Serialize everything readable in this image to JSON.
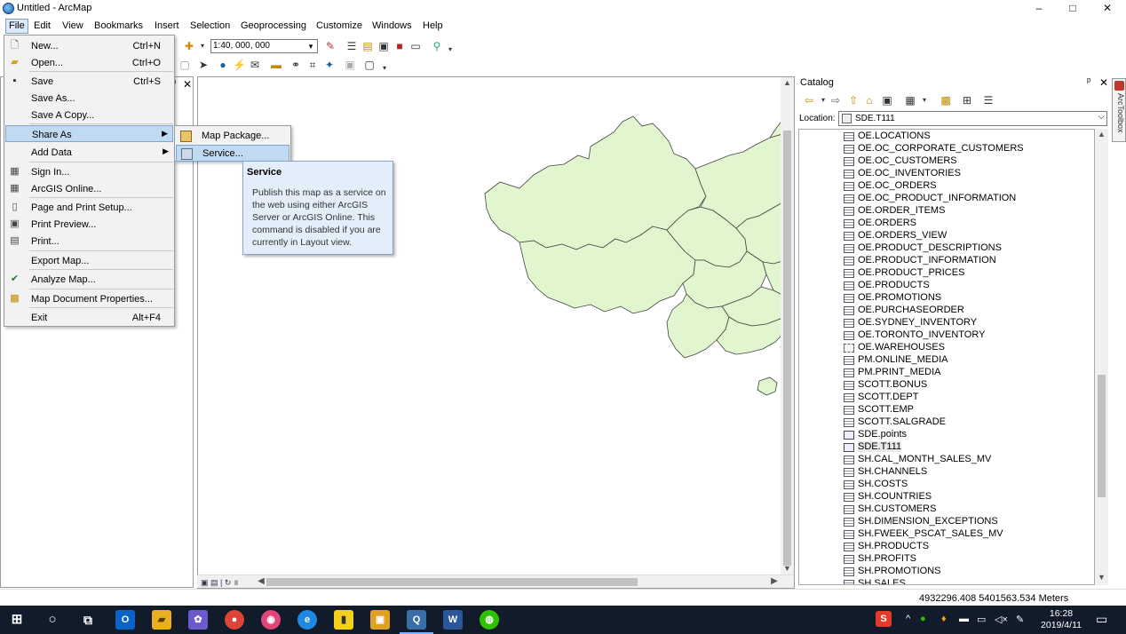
{
  "window": {
    "title": "Untitled - ArcMap",
    "controls": {
      "minimize": "–",
      "maximize": "□",
      "close": "✕"
    }
  },
  "menubar": [
    "File",
    "Edit",
    "View",
    "Bookmarks",
    "Insert",
    "Selection",
    "Geoprocessing",
    "Customize",
    "Windows",
    "Help"
  ],
  "toolbar": {
    "scale": "1:40, 000, 000"
  },
  "file_menu": {
    "items": [
      {
        "label": "New...",
        "shortcut": "Ctrl+N",
        "icon": "new-doc-icon"
      },
      {
        "label": "Open...",
        "shortcut": "Ctrl+O",
        "icon": "open-folder-icon"
      },
      {
        "label": "Save",
        "shortcut": "Ctrl+S",
        "icon": "save-icon"
      },
      {
        "label": "Save As...",
        "shortcut": "",
        "icon": ""
      },
      {
        "label": "Save A Copy...",
        "shortcut": "",
        "icon": ""
      },
      {
        "label": "Share As",
        "shortcut": "",
        "icon": "",
        "submenu": true
      },
      {
        "label": "Add Data",
        "shortcut": "",
        "icon": "",
        "submenu": true
      },
      {
        "label": "Sign In...",
        "shortcut": "",
        "icon": "sign-in-icon"
      },
      {
        "label": "ArcGIS Online...",
        "shortcut": "",
        "icon": "arcgis-online-icon"
      },
      {
        "label": "Page and Print Setup...",
        "shortcut": "",
        "icon": "page-setup-icon"
      },
      {
        "label": "Print Preview...",
        "shortcut": "",
        "icon": "print-preview-icon"
      },
      {
        "label": "Print...",
        "shortcut": "",
        "icon": "print-icon"
      },
      {
        "label": "Export Map...",
        "shortcut": "",
        "icon": ""
      },
      {
        "label": "Analyze Map...",
        "shortcut": "",
        "icon": "analyze-icon"
      },
      {
        "label": "Map Document Properties...",
        "shortcut": "",
        "icon": "properties-icon"
      },
      {
        "label": "Exit",
        "shortcut": "Alt+F4",
        "icon": ""
      }
    ]
  },
  "share_submenu": {
    "items": [
      {
        "label": "Map Package..."
      },
      {
        "label": "Service..."
      }
    ]
  },
  "tooltip": {
    "title": "Service",
    "body": "Publish this map as a service on the web using either ArcGIS Server or ArcGIS Online. This command is disabled if you are currently in Layout view."
  },
  "catalog": {
    "title": "Catalog",
    "location_label": "Location:",
    "location_value": "SDE.T111",
    "items": [
      {
        "label": "OE.LOCATIONS",
        "type": "table"
      },
      {
        "label": "OE.OC_CORPORATE_CUSTOMERS",
        "type": "table"
      },
      {
        "label": "OE.OC_CUSTOMERS",
        "type": "table"
      },
      {
        "label": "OE.OC_INVENTORIES",
        "type": "table"
      },
      {
        "label": "OE.OC_ORDERS",
        "type": "table"
      },
      {
        "label": "OE.OC_PRODUCT_INFORMATION",
        "type": "table"
      },
      {
        "label": "OE.ORDER_ITEMS",
        "type": "table"
      },
      {
        "label": "OE.ORDERS",
        "type": "table"
      },
      {
        "label": "OE.ORDERS_VIEW",
        "type": "table"
      },
      {
        "label": "OE.PRODUCT_DESCRIPTIONS",
        "type": "table"
      },
      {
        "label": "OE.PRODUCT_INFORMATION",
        "type": "table"
      },
      {
        "label": "OE.PRODUCT_PRICES",
        "type": "table"
      },
      {
        "label": "OE.PRODUCTS",
        "type": "table"
      },
      {
        "label": "OE.PROMOTIONS",
        "type": "table"
      },
      {
        "label": "OE.PURCHASEORDER",
        "type": "table"
      },
      {
        "label": "OE.SYDNEY_INVENTORY",
        "type": "table"
      },
      {
        "label": "OE.TORONTO_INVENTORY",
        "type": "table"
      },
      {
        "label": "OE.WAREHOUSES",
        "type": "view"
      },
      {
        "label": "PM.ONLINE_MEDIA",
        "type": "table"
      },
      {
        "label": "PM.PRINT_MEDIA",
        "type": "table"
      },
      {
        "label": "SCOTT.BONUS",
        "type": "table"
      },
      {
        "label": "SCOTT.DEPT",
        "type": "table"
      },
      {
        "label": "SCOTT.EMP",
        "type": "table"
      },
      {
        "label": "SCOTT.SALGRADE",
        "type": "table"
      },
      {
        "label": "SDE.points",
        "type": "featureclass"
      },
      {
        "label": "SDE.T111",
        "type": "featureclass",
        "selected": true
      },
      {
        "label": "SH.CAL_MONTH_SALES_MV",
        "type": "table"
      },
      {
        "label": "SH.CHANNELS",
        "type": "table"
      },
      {
        "label": "SH.COSTS",
        "type": "table"
      },
      {
        "label": "SH.COUNTRIES",
        "type": "table"
      },
      {
        "label": "SH.CUSTOMERS",
        "type": "table"
      },
      {
        "label": "SH.DIMENSION_EXCEPTIONS",
        "type": "table"
      },
      {
        "label": "SH.FWEEK_PSCAT_SALES_MV",
        "type": "table"
      },
      {
        "label": "SH.PRODUCTS",
        "type": "table"
      },
      {
        "label": "SH.PROFITS",
        "type": "table"
      },
      {
        "label": "SH.PROMOTIONS",
        "type": "table"
      },
      {
        "label": "SH.SALES",
        "type": "table"
      }
    ],
    "side_tab": "ArcToolbox"
  },
  "status": {
    "coords": "4932296.408  5401563.534 Meters"
  },
  "taskbar": {
    "time": "16:28",
    "date": "2019/4/11"
  },
  "colors": {
    "map_fill": "#e1f5cf",
    "map_stroke": "#444444",
    "highlight": "#c2d9f2",
    "taskbar": "#111b2a"
  }
}
